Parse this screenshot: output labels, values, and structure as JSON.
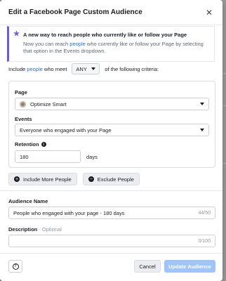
{
  "modal": {
    "title": "Edit a Facebook Page Custom Audience"
  },
  "banner": {
    "title": "A new way to reach people who currently like or follow your Page",
    "body_before": "Now you can reach ",
    "body_link": "people",
    "body_after": " who currently like or follow your Page by selecting that option in the Events dropdown."
  },
  "criteria": {
    "prefix": "Include ",
    "link": "people",
    "middle": " who meet",
    "any_value": "ANY",
    "suffix": "of the following criteria:"
  },
  "rule": {
    "page_label": "Page",
    "page_value": "Optimize Smart",
    "events_label": "Events",
    "events_value": "Everyone who engaged with your Page",
    "retention_label": "Retention",
    "retention_value": "180",
    "retention_unit": "days"
  },
  "buttons": {
    "include_more": "Include More People",
    "exclude": "Exclude People"
  },
  "audience": {
    "name_label": "Audience Name",
    "name_value": "People who engaged with your page - 180 days",
    "name_counter": "44/50",
    "description_label": "Description",
    "description_optional": " · Optional",
    "description_value": "",
    "description_counter": "0/100"
  },
  "footer": {
    "cancel": "Cancel",
    "update": "Update Audience"
  },
  "icons": {
    "close": "close-icon",
    "star": "star-icon",
    "info": "info-icon",
    "plus": "plus-circle-icon",
    "minus": "minus-circle-icon",
    "help": "help-icon"
  },
  "colors": {
    "accent": "#6a5ae0",
    "link": "#216fdb",
    "primary_disabled": "#a0c4f7"
  }
}
